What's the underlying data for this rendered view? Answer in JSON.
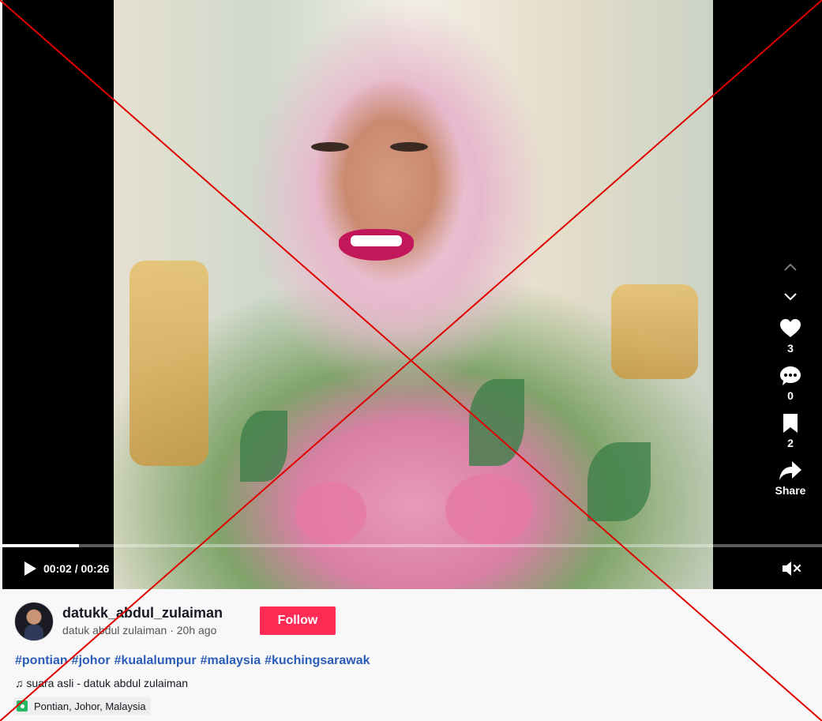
{
  "player": {
    "time_display": "00:02 / 00:26",
    "progress": 0.093,
    "muted": true
  },
  "actions": {
    "likes": "3",
    "comments": "0",
    "saves": "2",
    "share_label": "Share"
  },
  "author": {
    "username": "datukk_abdul_zulaiman",
    "display_name": "datuk abdul zulaiman",
    "time_ago": "20h ago",
    "follow_label": "Follow"
  },
  "hashtags": [
    "#pontian",
    "#johor",
    "#kualalumpur",
    "#malaysia",
    "#kuchingsarawak"
  ],
  "music": "♫ suara asli - datuk abdul zulaiman",
  "location": "Pontian, Johor, Malaysia",
  "colors": {
    "follow_button": "#fe2c55",
    "hashtag": "#2b5db8",
    "overlay_cross": "#e00000",
    "location_pin": "#25b865"
  },
  "icons": [
    "play-icon",
    "mute-icon",
    "chevron-up-icon",
    "chevron-down-icon",
    "heart-icon",
    "comment-icon",
    "bookmark-icon",
    "share-icon",
    "location-pin-icon"
  ]
}
